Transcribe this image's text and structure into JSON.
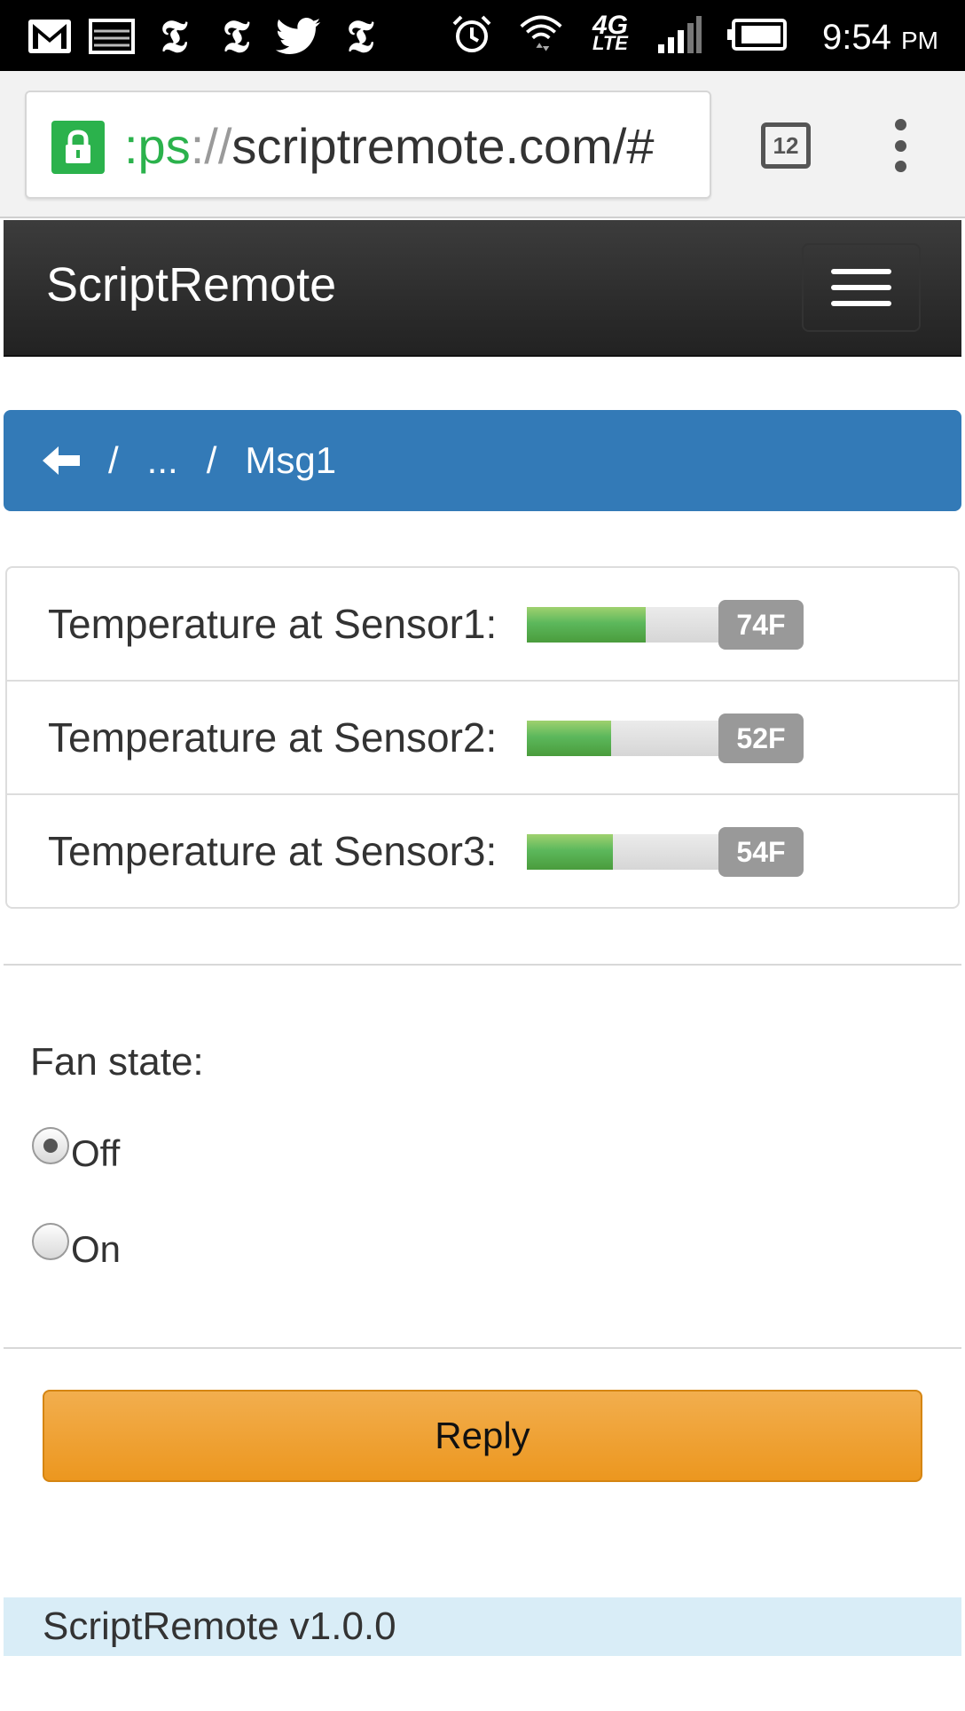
{
  "status_bar": {
    "left_icons": [
      "gmail-icon",
      "photo-icon",
      "nyt-icon",
      "nyt-icon",
      "twitter-icon",
      "nyt-icon"
    ],
    "network_label": "4G",
    "network_sub": "LTE",
    "time": "9:54",
    "ampm": "PM"
  },
  "browser": {
    "url_scheme": ":ps",
    "url_sep": "://",
    "url_host": "scriptremote.com/#",
    "tab_count": "12"
  },
  "navbar": {
    "brand": "ScriptRemote"
  },
  "breadcrumb": {
    "sep1": "/",
    "ellipsis": "...",
    "sep2": "/",
    "current": "Msg1"
  },
  "sensors": [
    {
      "label": "Temperature at Sensor1:",
      "value": "74F",
      "fill_fraction": 0.61
    },
    {
      "label": "Temperature at Sensor2:",
      "value": "52F",
      "fill_fraction": 0.43
    },
    {
      "label": "Temperature at Sensor3:",
      "value": "54F",
      "fill_fraction": 0.44
    }
  ],
  "form": {
    "fan_label": "Fan state:",
    "options": [
      {
        "label": "Off",
        "checked": true
      },
      {
        "label": "On",
        "checked": false
      }
    ]
  },
  "reply_button": "Reply",
  "footer": "ScriptRemote v1.0.0",
  "colors": {
    "navbar": "#2f2f2f",
    "breadcrumb": "#337ab7",
    "progress": "#5cb85c",
    "badge": "#999999",
    "reply": "#ec971f",
    "footer": "#d9edf7",
    "lock": "#2bb24c"
  }
}
